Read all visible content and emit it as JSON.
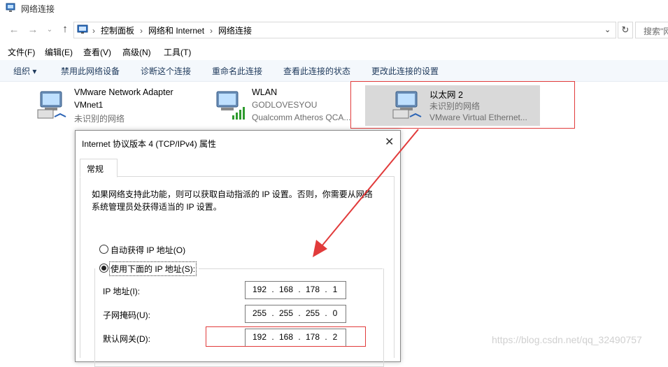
{
  "window": {
    "title": "网络连接"
  },
  "address": {
    "crumbs": [
      "控制面板",
      "网络和 Internet",
      "网络连接"
    ],
    "search_placeholder": "搜索\"网"
  },
  "menu": [
    "文件(F)",
    "编辑(E)",
    "查看(V)",
    "高级(N)",
    "工具(T)"
  ],
  "commands": [
    "组织 ▾",
    "禁用此网络设备",
    "诊断这个连接",
    "重命名此连接",
    "查看此连接的状态",
    "更改此连接的设置"
  ],
  "adapters": [
    {
      "name": "VMware Network Adapter",
      "line2": "VMnet1",
      "line3": "未识别的网络"
    },
    {
      "name": "WLAN",
      "line2": "GODLOVESYOU",
      "line3": "Qualcomm Atheros QCA..."
    },
    {
      "name": "以太网 2",
      "line2": "未识别的网络",
      "line3": "VMware Virtual Ethernet..."
    }
  ],
  "dialog": {
    "title": "Internet 协议版本 4 (TCP/IPv4) 属性",
    "tab": "常规",
    "description": "如果网络支持此功能，则可以获取自动指派的 IP 设置。否则，你需要从网络系统管理员处获得适当的 IP 设置。",
    "radio_auto": "自动获得 IP 地址(O)",
    "radio_manual": "使用下面的 IP 地址(S):",
    "fields": [
      {
        "label": "IP 地址(I):",
        "value": [
          "192",
          "168",
          "178",
          "1"
        ]
      },
      {
        "label": "子网掩码(U):",
        "value": [
          "255",
          "255",
          "255",
          "0"
        ]
      },
      {
        "label": "默认网关(D):",
        "value": [
          "192",
          "168",
          "178",
          "2"
        ]
      }
    ]
  },
  "watermark": "https://blog.csdn.net/qq_32490757",
  "colors": {
    "annotation_red": "#e13b3b",
    "command_text": "#1e395b",
    "selection": "#d9d9d9"
  }
}
